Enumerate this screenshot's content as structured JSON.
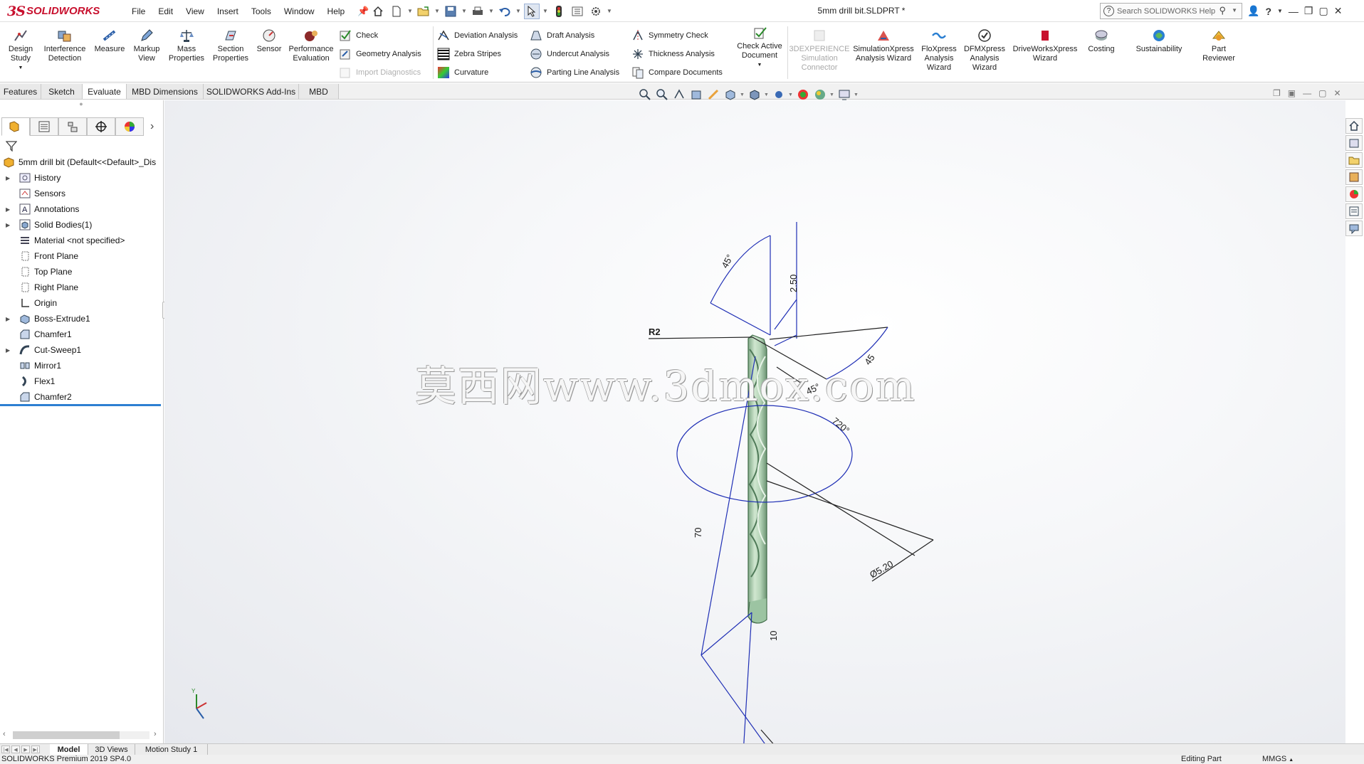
{
  "app": {
    "logo_ds": "3S",
    "logo_name": "SOLIDWORKS",
    "menu": [
      "File",
      "Edit",
      "View",
      "Insert",
      "Tools",
      "Window",
      "Help"
    ],
    "document_title": "5mm drill bit.SLDPRT *",
    "search_placeholder": "Search SOLIDWORKS Help"
  },
  "command_manager": {
    "large_buttons": [
      {
        "label": "Design Study",
        "icon": "design-study-icon"
      },
      {
        "label": "Interference Detection",
        "icon": "interference-detection-icon"
      },
      {
        "label": "Measure",
        "icon": "measure-icon"
      },
      {
        "label": "Markup View",
        "icon": "markup-icon"
      },
      {
        "label": "Mass Properties",
        "icon": "mass-properties-icon"
      },
      {
        "label": "Section Properties",
        "icon": "section-properties-icon"
      },
      {
        "label": "Sensor",
        "icon": "sensor-icon"
      },
      {
        "label": "Performance Evaluation",
        "icon": "performance-evaluation-icon"
      }
    ],
    "small_col1": [
      {
        "label": "Check",
        "disabled": false
      },
      {
        "label": "Geometry Analysis",
        "disabled": false
      },
      {
        "label": "Import Diagnostics",
        "disabled": true
      }
    ],
    "small_col2": [
      {
        "label": "Deviation Analysis"
      },
      {
        "label": "Zebra Stripes"
      },
      {
        "label": "Curvature"
      }
    ],
    "small_col3": [
      {
        "label": "Draft Analysis"
      },
      {
        "label": "Undercut Analysis"
      },
      {
        "label": "Parting Line Analysis"
      }
    ],
    "small_col4": [
      {
        "label": "Symmetry Check"
      },
      {
        "label": "Thickness Analysis"
      },
      {
        "label": "Compare Documents"
      }
    ],
    "check_active_doc": "Check Active Document",
    "right_buttons": [
      {
        "label": "3DEXPERIENCE Simulation Connector",
        "disabled": true
      },
      {
        "label": "SimulationXpress Analysis Wizard",
        "disabled": false
      },
      {
        "label": "FloXpress Analysis Wizard",
        "disabled": false
      },
      {
        "label": "DFMXpress Analysis Wizard",
        "disabled": false
      },
      {
        "label": "DriveWorksXpress Wizard",
        "disabled": false
      },
      {
        "label": "Costing",
        "disabled": false
      },
      {
        "label": "Sustainability",
        "disabled": false
      },
      {
        "label": "Part Reviewer",
        "disabled": false
      }
    ]
  },
  "tabs": [
    {
      "label": "Features",
      "active": false
    },
    {
      "label": "Sketch",
      "active": false
    },
    {
      "label": "Evaluate",
      "active": true
    },
    {
      "label": "MBD Dimensions",
      "active": false
    },
    {
      "label": "SOLIDWORKS Add-Ins",
      "active": false
    },
    {
      "label": "MBD",
      "active": false
    }
  ],
  "feature_tree": {
    "root": "5mm drill bit  (Default<<Default>_Dis",
    "items": [
      {
        "label": "History",
        "expandable": true,
        "icon": "history-icon"
      },
      {
        "label": "Sensors",
        "expandable": false,
        "icon": "sensors-icon"
      },
      {
        "label": "Annotations",
        "expandable": true,
        "icon": "annotations-icon"
      },
      {
        "label": "Solid Bodies(1)",
        "expandable": true,
        "icon": "solid-bodies-icon"
      },
      {
        "label": "Material <not specified>",
        "expandable": false,
        "icon": "material-icon"
      },
      {
        "label": "Front Plane",
        "expandable": false,
        "icon": "plane-icon"
      },
      {
        "label": "Top Plane",
        "expandable": false,
        "icon": "plane-icon"
      },
      {
        "label": "Right Plane",
        "expandable": false,
        "icon": "plane-icon"
      },
      {
        "label": "Origin",
        "expandable": false,
        "icon": "origin-icon"
      },
      {
        "label": "Boss-Extrude1",
        "expandable": true,
        "icon": "extrude-icon"
      },
      {
        "label": "Chamfer1",
        "expandable": false,
        "icon": "chamfer-icon"
      },
      {
        "label": "Cut-Sweep1",
        "expandable": true,
        "icon": "sweep-icon"
      },
      {
        "label": "Mirror1",
        "expandable": false,
        "icon": "mirror-icon"
      },
      {
        "label": "Flex1",
        "expandable": false,
        "icon": "flex-icon"
      },
      {
        "label": "Chamfer2",
        "expandable": false,
        "icon": "chamfer-icon"
      }
    ]
  },
  "model": {
    "dimensions": [
      "45°",
      "2.50",
      "R2",
      "45",
      "45°",
      "720°",
      "70",
      "Ø5.20",
      "10"
    ],
    "watermark": "莫西网www.3dmox.com",
    "dim_color": "#1f2fb5",
    "body_color": "#b8d9bb"
  },
  "bottom_tabs": [
    {
      "label": "Model",
      "active": true
    },
    {
      "label": "3D Views",
      "active": false
    },
    {
      "label": "Motion Study 1",
      "active": false
    }
  ],
  "status": {
    "version": "SOLIDWORKS Premium 2019 SP4.0",
    "mode": "Editing Part",
    "units": "MMGS"
  }
}
